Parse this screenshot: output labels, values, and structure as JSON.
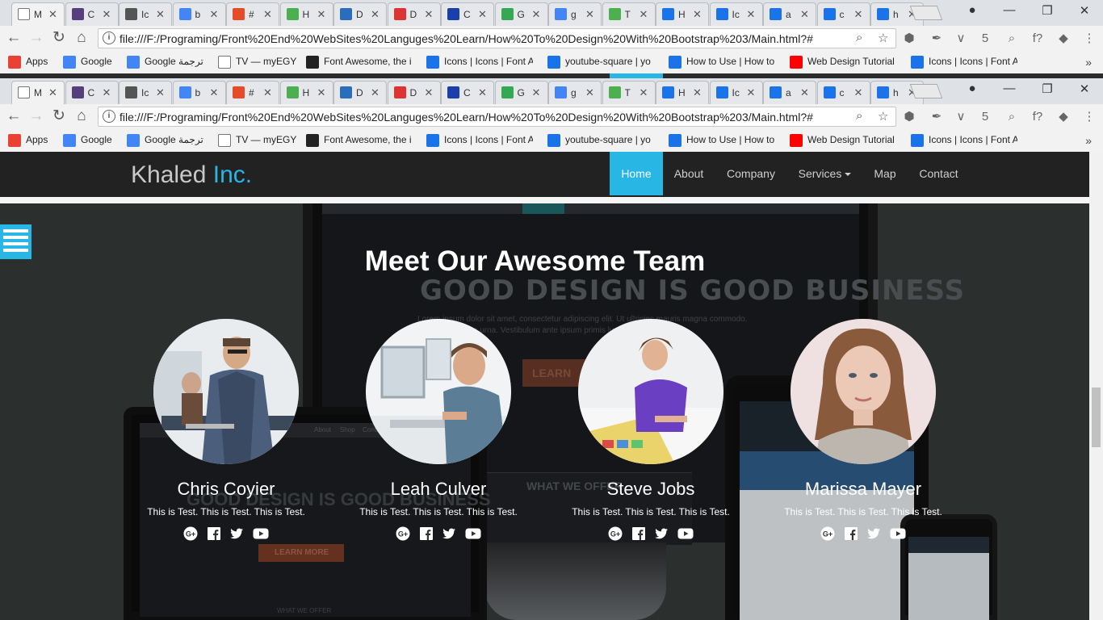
{
  "browser": {
    "tabs": [
      {
        "label": "M",
        "icon": "page-icon",
        "color": "#ffffff"
      },
      {
        "label": "C",
        "icon": "bootstrap-icon",
        "color": "#563d7c"
      },
      {
        "label": "Ic",
        "icon": "glasses-icon",
        "color": "#555555"
      },
      {
        "label": "b",
        "icon": "google-icon",
        "color": "#4285f4"
      },
      {
        "label": "#",
        "icon": "hex-icon",
        "color": "#e34c26"
      },
      {
        "label": "H",
        "icon": "w3-icon",
        "color": "#4caf50"
      },
      {
        "label": "D",
        "icon": "globe-icon",
        "color": "#2a6ebb"
      },
      {
        "label": "D",
        "icon": "facebook-icon",
        "color": "#dd3333"
      },
      {
        "label": "C",
        "icon": "devtools-icon",
        "color": "#1a3fa8"
      },
      {
        "label": "G",
        "icon": "chrome-icon",
        "color": "#34a853"
      },
      {
        "label": "g",
        "icon": "google-icon",
        "color": "#4285f4"
      },
      {
        "label": "T",
        "icon": "w3-icon",
        "color": "#4caf50"
      },
      {
        "label": "H",
        "icon": "flag-icon",
        "color": "#1a73e8"
      },
      {
        "label": "Ic",
        "icon": "flag-icon",
        "color": "#1a73e8"
      },
      {
        "label": "a",
        "icon": "flag-icon",
        "color": "#1a73e8"
      },
      {
        "label": "c",
        "icon": "flag-icon",
        "color": "#1a73e8"
      },
      {
        "label": "h",
        "icon": "flag-icon",
        "color": "#1a73e8"
      }
    ],
    "url": "file:///F:/Programing/Front%20End%20WebSites%20Languges%20Learn/How%20To%20Design%20With%20Bootstrap%203/Main.html?#",
    "bookmarks": [
      {
        "label": "Apps",
        "icon": "apps-grid-icon",
        "color": "#e94235"
      },
      {
        "label": "Google",
        "icon": "google-icon",
        "color": "#4285f4"
      },
      {
        "label": "Google ترجمة",
        "icon": "translate-icon",
        "color": "#4285f4"
      },
      {
        "label": "TV — myEGY",
        "icon": "page-icon",
        "color": "#ffffff"
      },
      {
        "label": "Font Awesome, the i",
        "icon": "flag-icon",
        "color": "#222222"
      },
      {
        "label": "Icons | Icons | Font A",
        "icon": "flag-icon",
        "color": "#1a73e8"
      },
      {
        "label": "youtube-square | yo",
        "icon": "flag-icon",
        "color": "#1a73e8"
      },
      {
        "label": "How to Use | How to",
        "icon": "flag-icon",
        "color": "#1a73e8"
      },
      {
        "label": "Web Design Tutorial",
        "icon": "youtube-icon",
        "color": "#ff0000"
      },
      {
        "label": "Icons | Icons | Font A",
        "icon": "flag-icon",
        "color": "#1a73e8"
      }
    ],
    "more": "»"
  },
  "site": {
    "brand_main": "Khaled",
    "brand_accent": "Inc.",
    "accent_color": "#28b6e5",
    "nav": [
      {
        "label": "Home",
        "active": true
      },
      {
        "label": "About"
      },
      {
        "label": "Company"
      },
      {
        "label": "Services"
      },
      {
        "label": "Map"
      },
      {
        "label": "Contact"
      }
    ]
  },
  "background_mock": {
    "headline": "GOOD DESIGN IS GOOD BUSINESS",
    "text": "Lorem ipsum dolor sit amet, consectetur adipiscing elit. Ut ultricies mauris magna commodo.",
    "text2": "cursus urna. Vestibulum ante ipsum primis luctus et ultrices.",
    "button": "LEARN",
    "offer": "WHAT WE OFFER",
    "laptop_headline": "GOOD DESIGN IS GOOD BUSINESS",
    "laptop_button": "LEARN MORE",
    "laptop_offer": "WHAT WE OFFER",
    "laptop_nav": [
      "About",
      "Shop",
      "Contact"
    ]
  },
  "team": {
    "title": "Meet Our Awesome Team",
    "members": [
      {
        "name": "Chris Coyier",
        "desc": "This is Test. This is Test. This is Test.",
        "icons": [
          "google-plus-icon",
          "facebook-icon",
          "twitter-icon",
          "youtube-icon"
        ]
      },
      {
        "name": "Leah Culver",
        "desc": "This is Test. This is Test. This is Test.",
        "icons": [
          "google-plus-icon",
          "facebook-icon",
          "twitter-icon",
          "youtube-icon"
        ]
      },
      {
        "name": "Steve Jobs",
        "desc": "This is Test. This is Test. This is Test.",
        "icons": [
          "google-plus-icon",
          "facebook-icon",
          "twitter-icon",
          "youtube-icon"
        ]
      },
      {
        "name": "Marissa Mayer",
        "desc": "This is Test. This is Test. This is Test.",
        "icons": [
          "google-plus-icon",
          "facebook-icon",
          "twitter-icon",
          "youtube-icon"
        ]
      }
    ]
  }
}
